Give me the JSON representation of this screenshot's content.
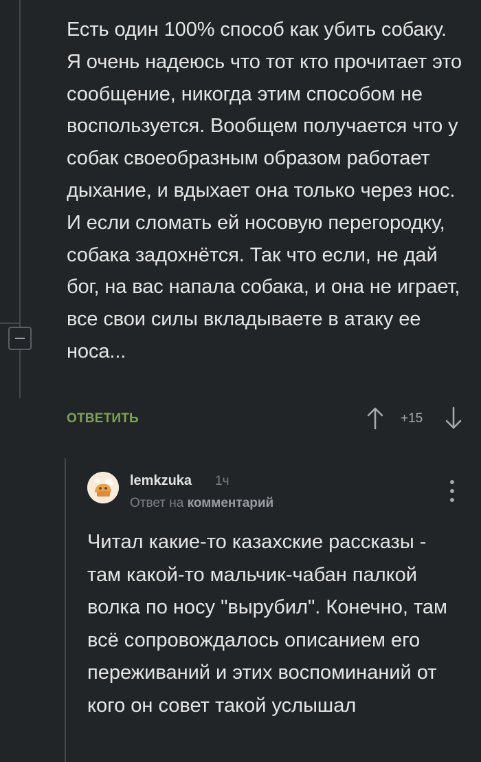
{
  "parent_comment": {
    "text": "Есть один 100% способ как убить собаку. Я очень надеюсь что тот кто прочитает это сообщение, никогда этим способом не воспользуется. Вообщем получается что у собак своеобразным образом работает дыхание, и вдыхает она только через нос. И если сломать ей носовую перегородку, собака задохнётся. Так что если, не дай бог, на вас напала собака, и она не играет, все свои силы вкладываете в атаку ее носа...",
    "reply_label": "ОТВЕТИТЬ",
    "rating": "+15",
    "upvote_icon": "arrow-up-icon",
    "downvote_icon": "arrow-down-icon",
    "collapse_icon": "minus-icon"
  },
  "reply_comment": {
    "username": "lemkzuka",
    "time": "1ч",
    "reply_to_prefix": "Ответ на",
    "reply_to_target": "комментарий",
    "text": "Читал какие-то казахские рассказы - там какой-то мальчик-чабан палкой волка по носу \"вырубил\". Конечно, там всё сопровождалось описанием его переживаний и этих воспоминаний от кого он совет такой услышал",
    "menu_icon": "more-vertical-icon"
  },
  "colors": {
    "background": "#222527",
    "text": "#e5e5e5",
    "accent_green": "#7da35a",
    "muted": "#7c8086",
    "thread_line": "#45494d"
  }
}
